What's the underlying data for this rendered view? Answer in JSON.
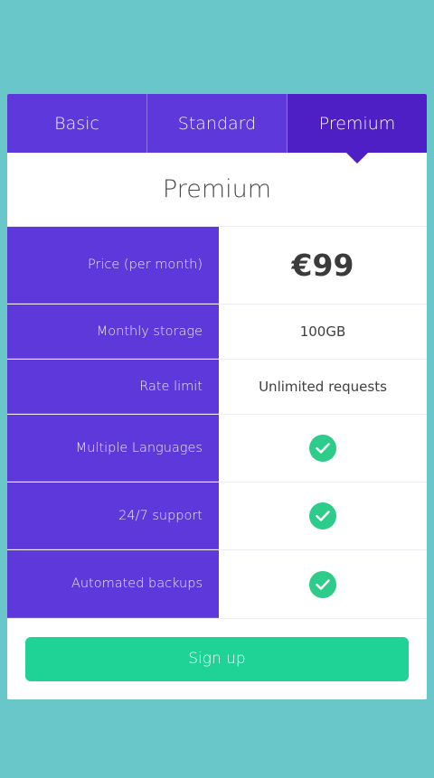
{
  "tabs": [
    {
      "label": "Basic"
    },
    {
      "label": "Standard"
    },
    {
      "label": "Premium"
    }
  ],
  "active_tab": "Premium",
  "plan": {
    "title": "Premium",
    "rows": [
      {
        "label": "Price (per month)",
        "value": "€99"
      },
      {
        "label": "Monthly storage",
        "value": "100GB"
      },
      {
        "label": "Rate limit",
        "value": "Unlimited requests"
      },
      {
        "label": "Multiple Languages",
        "value": "check-icon"
      },
      {
        "label": "24/7 support",
        "value": "check-icon"
      },
      {
        "label": "Automated backups",
        "value": "check-icon"
      }
    ]
  },
  "signup_label": "Sign up",
  "colors": {
    "background": "#69c6c9",
    "tab": "#5f38dc",
    "tab_active": "#4d1fc4",
    "row_label_bg": "#5f38dc",
    "check": "#2ecc8a",
    "signup_button": "#1fd296"
  }
}
